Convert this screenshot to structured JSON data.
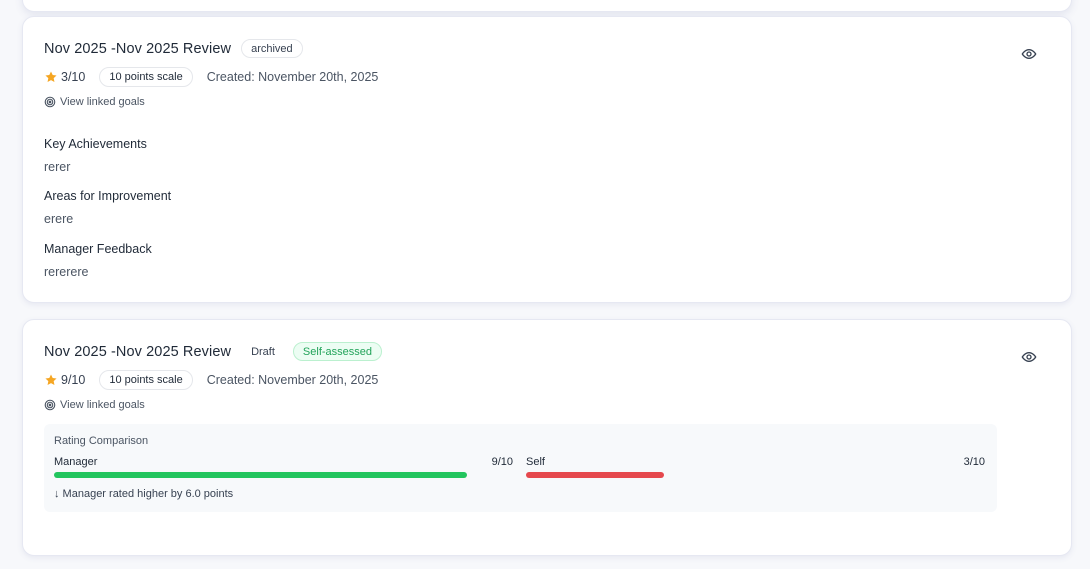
{
  "reviews": [
    {
      "title": "Nov 2025 -Nov 2025 Review",
      "status": "archived",
      "rating": "3/10",
      "scale": "10 points scale",
      "created": "Created: November 20th, 2025",
      "linked_goals": "View linked goals",
      "sections": [
        {
          "title": "Key Achievements",
          "body": "rerer"
        },
        {
          "title": "Areas for Improvement",
          "body": "erere"
        },
        {
          "title": "Manager Feedback",
          "body": "rererere"
        }
      ]
    },
    {
      "title": "Nov 2025 -Nov 2025 Review",
      "status": "Draft",
      "assessment": "Self-assessed",
      "rating": "9/10",
      "scale": "10 points scale",
      "created": "Created: November 20th, 2025",
      "linked_goals": "View linked goals",
      "comparison": {
        "title": "Rating Comparison",
        "manager_label": "Manager",
        "manager_value": "9/10",
        "manager_fraction": 0.9,
        "self_label": "Self",
        "self_value": "3/10",
        "self_fraction": 0.3,
        "note": "↓ Manager rated higher by 6.0 points"
      }
    }
  ],
  "colors": {
    "star": "#f5a623",
    "manager_bar": "#22c55e",
    "self_bar": "#e5484d",
    "self_assessed": "#22a35a"
  },
  "icons": {
    "star": "star-icon",
    "eye": "eye-icon",
    "target": "target-icon"
  }
}
